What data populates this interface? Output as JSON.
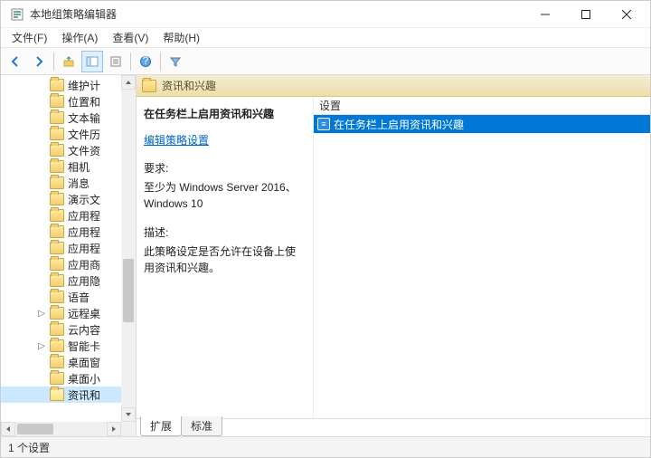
{
  "window": {
    "title": "本地组策略编辑器"
  },
  "menus": {
    "file": "文件(F)",
    "action": "操作(A)",
    "view": "查看(V)",
    "help": "帮助(H)"
  },
  "tree_items": [
    {
      "label": "维护计"
    },
    {
      "label": "位置和"
    },
    {
      "label": "文本输"
    },
    {
      "label": "文件历"
    },
    {
      "label": "文件资"
    },
    {
      "label": "相机"
    },
    {
      "label": "消息"
    },
    {
      "label": "演示文"
    },
    {
      "label": "应用程"
    },
    {
      "label": "应用程"
    },
    {
      "label": "应用程"
    },
    {
      "label": "应用商"
    },
    {
      "label": "应用隐"
    },
    {
      "label": "语音"
    },
    {
      "label": "远程桌",
      "expandable": true
    },
    {
      "label": "云内容"
    },
    {
      "label": "智能卡",
      "expandable": true
    },
    {
      "label": "桌面窗"
    },
    {
      "label": "桌面小"
    },
    {
      "label": "资讯和",
      "selected": true
    }
  ],
  "header": {
    "title": "资讯和兴趣"
  },
  "detail": {
    "title": "在任务栏上启用资讯和兴趣",
    "edit_link": "编辑策略设置",
    "req_label": "要求:",
    "req_text": "至少为 Windows Server 2016、Windows 10",
    "desc_label": "描述:",
    "desc_text": "此策略设定是否允许在设备上使用资讯和兴趣。"
  },
  "list": {
    "col_setting": "设置",
    "rows": [
      {
        "label": "在任务栏上启用资讯和兴趣",
        "selected": true
      }
    ]
  },
  "tabs": {
    "extended": "扩展",
    "standard": "标准"
  },
  "status": {
    "text": "1 个设置"
  }
}
